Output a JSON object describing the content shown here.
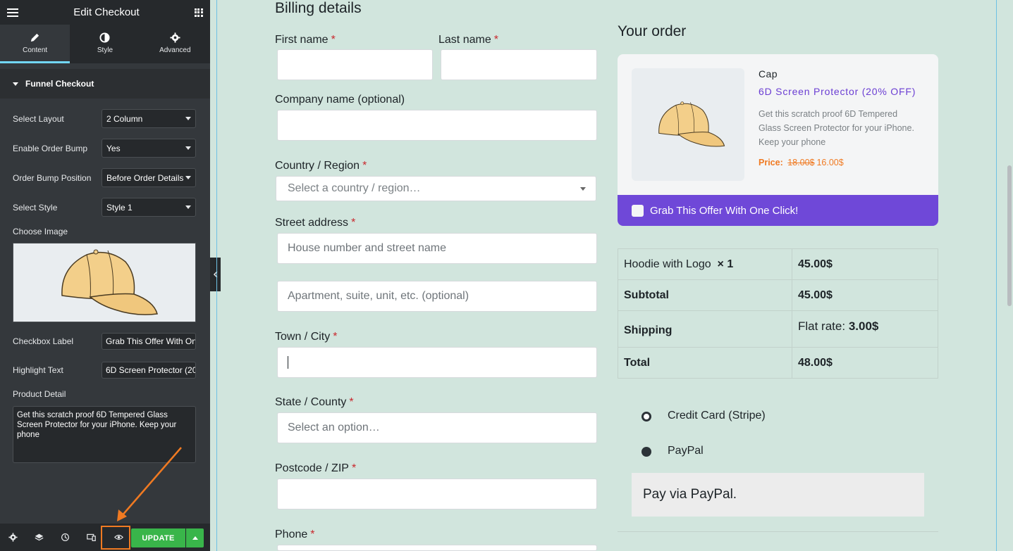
{
  "panel": {
    "title": "Edit Checkout",
    "tabs": [
      {
        "label": "Content",
        "icon": "pencil-icon"
      },
      {
        "label": "Style",
        "icon": "half-circle-icon"
      },
      {
        "label": "Advanced",
        "icon": "gear-icon"
      }
    ],
    "section_title": "Funnel Checkout",
    "controls": {
      "layout": {
        "label": "Select Layout",
        "value": "2 Column"
      },
      "order_bump": {
        "label": "Enable Order Bump",
        "value": "Yes"
      },
      "bump_position": {
        "label": "Order Bump Position",
        "value": "Before Order Details"
      },
      "style": {
        "label": "Select Style",
        "value": "Style 1"
      },
      "image_label": "Choose Image",
      "checkbox_label": {
        "label": "Checkbox Label",
        "value": "Grab This Offer With One Click!"
      },
      "highlight_text": {
        "label": "Highlight Text",
        "value": "6D Screen Protector (20% OFF)"
      },
      "product_detail": {
        "label": "Product Detail",
        "value": "Get this scratch proof 6D Tempered Glass Screen Protector for your iPhone. Keep your phone"
      }
    },
    "footer": {
      "update_label": "UPDATE",
      "icons": [
        "settings-icon",
        "layers-icon",
        "history-icon",
        "responsive-icon",
        "eye-icon"
      ]
    },
    "highlight_color": "#f07a22"
  },
  "billing": {
    "heading": "Billing details",
    "first_name": {
      "label": "First name",
      "req": "*"
    },
    "last_name": {
      "label": "Last name",
      "req": "*"
    },
    "company": {
      "label": "Company name (optional)"
    },
    "country": {
      "label": "Country / Region",
      "req": "*",
      "placeholder": "Select a country / region…"
    },
    "street": {
      "label": "Street address",
      "req": "*",
      "placeholder1": "House number and street name",
      "placeholder2": "Apartment, suite, unit, etc. (optional)"
    },
    "city": {
      "label": "Town / City",
      "req": "*"
    },
    "state": {
      "label": "State / County",
      "req": "*",
      "placeholder": "Select an option…"
    },
    "postcode": {
      "label": "Postcode / ZIP",
      "req": "*"
    },
    "phone": {
      "label": "Phone",
      "req": "*"
    }
  },
  "order": {
    "heading": "Your order",
    "bump": {
      "title": "Cap",
      "highlight": "6D Screen Protector (20% OFF)",
      "description": "Get this scratch proof 6D Tempered Glass Screen Protector for your iPhone. Keep your phone",
      "price_label": "Price:",
      "old_price": "18.00$",
      "new_price": "16.00$",
      "checkbox_label": "Grab This Offer With One Click!",
      "accent_color": "#6f48d8"
    },
    "items": [
      {
        "name": "Hoodie with Logo",
        "qty": "× 1",
        "total": "45.00$"
      }
    ],
    "subtotal": {
      "label": "Subtotal",
      "value": "45.00$"
    },
    "shipping": {
      "label": "Shipping",
      "method": "Flat rate:",
      "value": "3.00$"
    },
    "total": {
      "label": "Total",
      "value": "48.00$"
    }
  },
  "payment": {
    "methods": [
      {
        "label": "Credit Card (Stripe)",
        "selected": false
      },
      {
        "label": "PayPal",
        "selected": true
      }
    ],
    "description": "Pay via PayPal."
  }
}
